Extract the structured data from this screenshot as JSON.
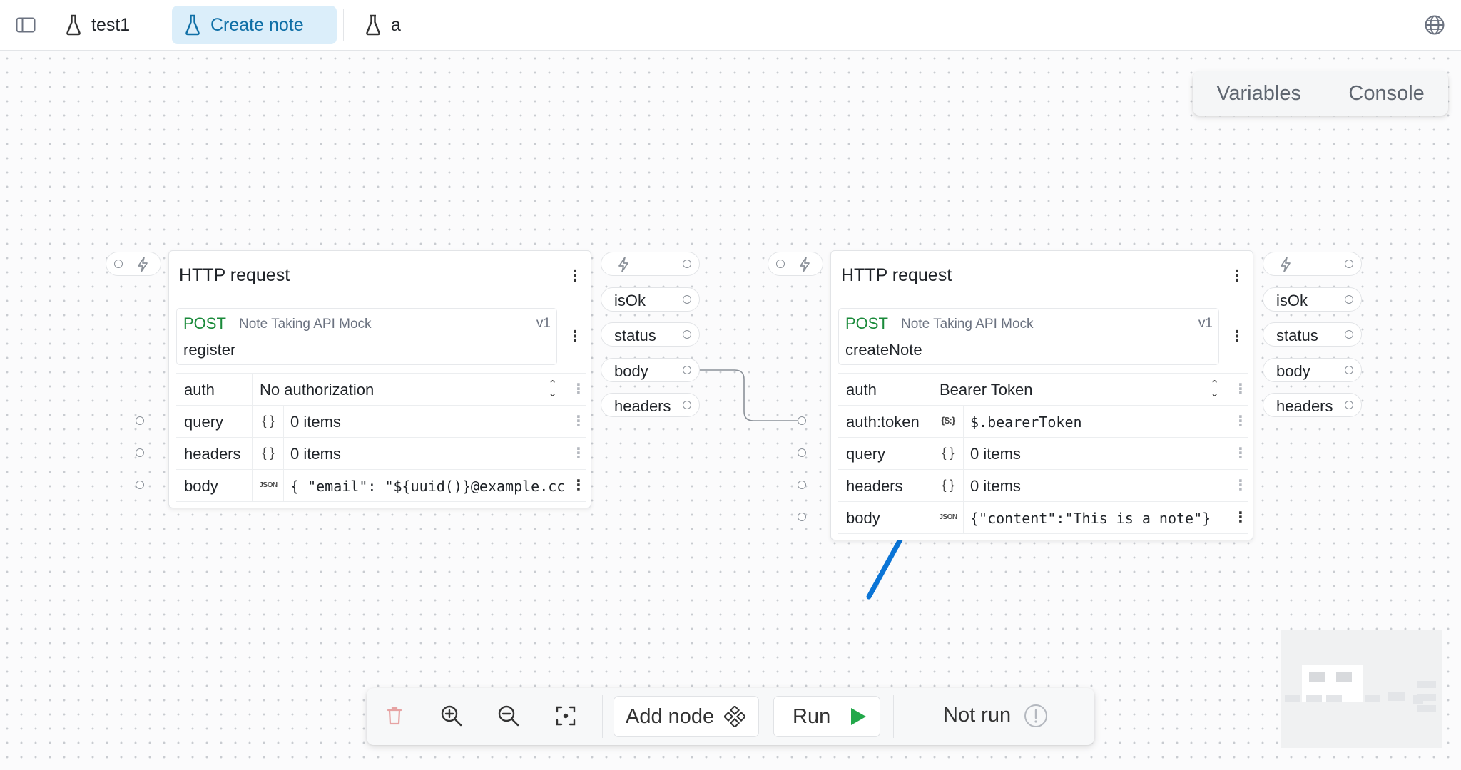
{
  "tabs": [
    {
      "label": "test1",
      "active": false
    },
    {
      "label": "Create note",
      "active": true
    },
    {
      "label": "a",
      "active": false
    }
  ],
  "panel": {
    "variables": "Variables",
    "console": "Console"
  },
  "node1": {
    "title": "HTTP request",
    "method": "POST",
    "api": "Note Taking API Mock",
    "version": "v1",
    "operation": "register",
    "params": {
      "auth": {
        "name": "auth",
        "value": "No authorization"
      },
      "query": {
        "name": "query",
        "icon": "{ }",
        "value": "0 items"
      },
      "headers": {
        "name": "headers",
        "icon": "{ }",
        "value": "0 items"
      },
      "body": {
        "name": "body",
        "icon": "JSON",
        "value": "{ \"email\": \"${uuid()}@example.cc"
      }
    },
    "outputs": [
      "isOk",
      "status",
      "body",
      "headers"
    ]
  },
  "node2": {
    "title": "HTTP request",
    "method": "POST",
    "api": "Note Taking API Mock",
    "version": "v1",
    "operation": "createNote",
    "params": {
      "auth": {
        "name": "auth",
        "value": "Bearer Token"
      },
      "token": {
        "name": "auth:token",
        "icon": "{$:}",
        "value": "$.bearerToken"
      },
      "query": {
        "name": "query",
        "icon": "{ }",
        "value": "0 items"
      },
      "headers": {
        "name": "headers",
        "icon": "{ }",
        "value": "0 items"
      },
      "body": {
        "name": "body",
        "icon": "JSON",
        "value": "{\"content\":\"This is a note\"}"
      }
    },
    "outputs": [
      "isOk",
      "status",
      "body",
      "headers"
    ]
  },
  "toolbar": {
    "add_node": "Add node",
    "run": "Run",
    "status": "Not run"
  },
  "colors": {
    "accent": "#0f6fa6",
    "method": "#1a8a3a",
    "run": "#22a84a",
    "annotation_arrow": "#0a74d6"
  }
}
